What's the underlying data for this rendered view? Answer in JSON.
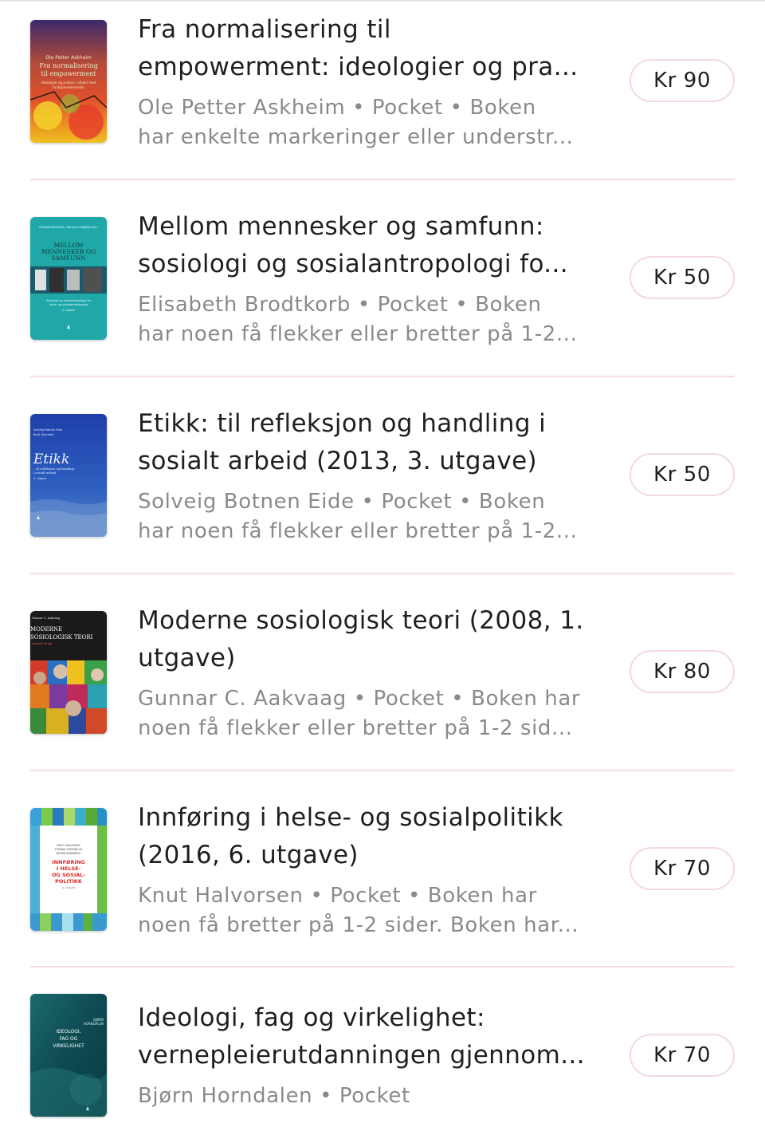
{
  "books": [
    {
      "title_line1": "Fra normalisering til",
      "title_line2": "empowerment: ideologier og pra...",
      "meta_line1": "Ole Petter Askheim • Pocket • Boken",
      "meta_line2": "har enkelte markeringer eller understr...",
      "price": "Kr 90",
      "cover_text": [
        "Ole Petter Askheim",
        "Fra normalisering",
        "til empowerment",
        "Ideologier og praksis i arbeid med",
        "funksjonshemmede"
      ]
    },
    {
      "title_line1": "Mellom mennesker og samfunn:",
      "title_line2": "sosiologi og sosialantropologi fo...",
      "meta_line1": "Elisabeth Brodtkorb • Pocket • Boken",
      "meta_line2": "har noen få flekker eller bretter på 1-2...",
      "price": "Kr 50",
      "cover_text": [
        "Elisabeth Brodtkorb · Marianne Rugkåsa (red.)",
        "MELLOM",
        "MENNESKER OG",
        "SAMFUNN",
        "Sosiologi og sosialantropologi for",
        "helse- og sosialprofesjonene",
        "2. utgave"
      ]
    },
    {
      "title_line1": "Etikk: til refleksjon og handling i",
      "title_line2": "sosialt arbeid (2013, 3. utgave)",
      "meta_line1": "Solveig Botnen Eide • Pocket • Boken",
      "meta_line2": "har noen få flekker eller bretter på 1-2...",
      "price": "Kr 50",
      "cover_text": [
        "Solveig Botnen Eide",
        "Berit Skorstad",
        "Etikk",
        "– til refleksjon og handling",
        "i sosialt arbeid",
        "3. utgave"
      ]
    },
    {
      "title_line1": "Moderne sosiologisk teori (2008, 1.",
      "title_line2": "utgave)",
      "meta_line1": "Gunnar C. Aakvaag • Pocket • Boken har",
      "meta_line2": "noen få flekker eller bretter på 1-2 sid...",
      "price": "Kr 80",
      "cover_text": [
        "Gunnar C. Aakvaag",
        "MODERNE",
        "SOSIOLOGISK TEORI",
        "abstrakt forlag"
      ]
    },
    {
      "title_line1": "Innføring i helse- og sosialpolitikk",
      "title_line2": "(2016, 6. utgave)",
      "meta_line1": "Knut Halvorsen • Pocket • Boken har",
      "meta_line2": "noen få bretter på 1-2 sider. Boken har...",
      "price": "Kr 70",
      "cover_text": [
        "KNUT HALVORSEN",
        "STEINAR STJERNØ OG",
        "ØIVIND ØVREBERG",
        "INNFØRING",
        "I HELSE-",
        "OG SOSIAL-",
        "POLITIKK",
        "6. UTGAVE"
      ]
    },
    {
      "title_line1": "Ideologi, fag og virkelighet:",
      "title_line2": "vernepleierutdanningen gjennom...",
      "meta_line1": "Bjørn Horndalen • Pocket",
      "meta_line2": "",
      "price": "Kr 70",
      "cover_text": [
        "BJØRN",
        "HORNDALEN",
        "IDEOLOGI,",
        "FAG OG",
        "VIRKELIGHET"
      ]
    }
  ]
}
